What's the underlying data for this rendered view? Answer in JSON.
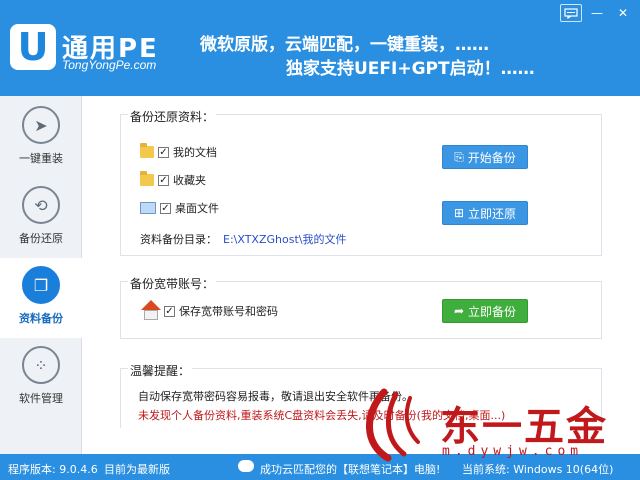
{
  "header": {
    "logo_letter": "U",
    "brand": "通用PE",
    "brand_sub": "TongYongPe.com",
    "slogan_line1": "微软原版，云端匹配，一键重装，……",
    "slogan_line2": "独家支持UEFI+GPT启动！……",
    "colors": {
      "header_bg": "#2a8fe0",
      "accent": "#1a7fdb"
    }
  },
  "window_controls": {
    "feedback_icon": "message-icon",
    "minimize": "—",
    "close": "✕"
  },
  "sidebar": {
    "items": [
      {
        "label": "一键重装",
        "icon": "cursor-icon",
        "glyph": "➤",
        "active": false
      },
      {
        "label": "备份还原",
        "icon": "sync-icon",
        "glyph": "⟲",
        "active": false
      },
      {
        "label": "资料备份",
        "icon": "copy-icon",
        "glyph": "❐",
        "active": true
      },
      {
        "label": "软件管理",
        "icon": "grid-icon",
        "glyph": "⁘",
        "active": false
      }
    ]
  },
  "backup_section": {
    "title": "备份还原资料：",
    "items": [
      {
        "label": "我的文档",
        "checked": true,
        "icon": "folder-icon"
      },
      {
        "label": "收藏夹",
        "checked": true,
        "icon": "folder-icon"
      },
      {
        "label": "桌面文件",
        "checked": true,
        "icon": "desktop-icon"
      }
    ],
    "start_backup_button": "开始备份",
    "restore_button": "立即还原",
    "path_label": "资料备份目录：",
    "path_value": "E:\\XTXZGhost\\我的文件"
  },
  "broadband_section": {
    "title": "备份宽带账号：",
    "item_label": "保存宽带账号和密码",
    "item_checked": true,
    "backup_now_button": "立即备份"
  },
  "tips_section": {
    "title": "温馨提醒：",
    "line1": "自动保存宽带密码容易报毒，敬请退出安全软件再备份。",
    "line2": "未发现个人备份资料,重装系统C盘资料会丢失,请及时备份(我的文档,桌面...)",
    "line2_color": "#c0181b"
  },
  "statusbar": {
    "version": "程序版本: 9.0.4.6",
    "update_status": "目前为最新版",
    "cloud_status": "成功云匹配您的【联想笔记本】电脑!",
    "os_info": "当前系统: Windows 10(64位)"
  },
  "watermark": {
    "text": "东一五金",
    "url": "m.dywjw.com"
  }
}
